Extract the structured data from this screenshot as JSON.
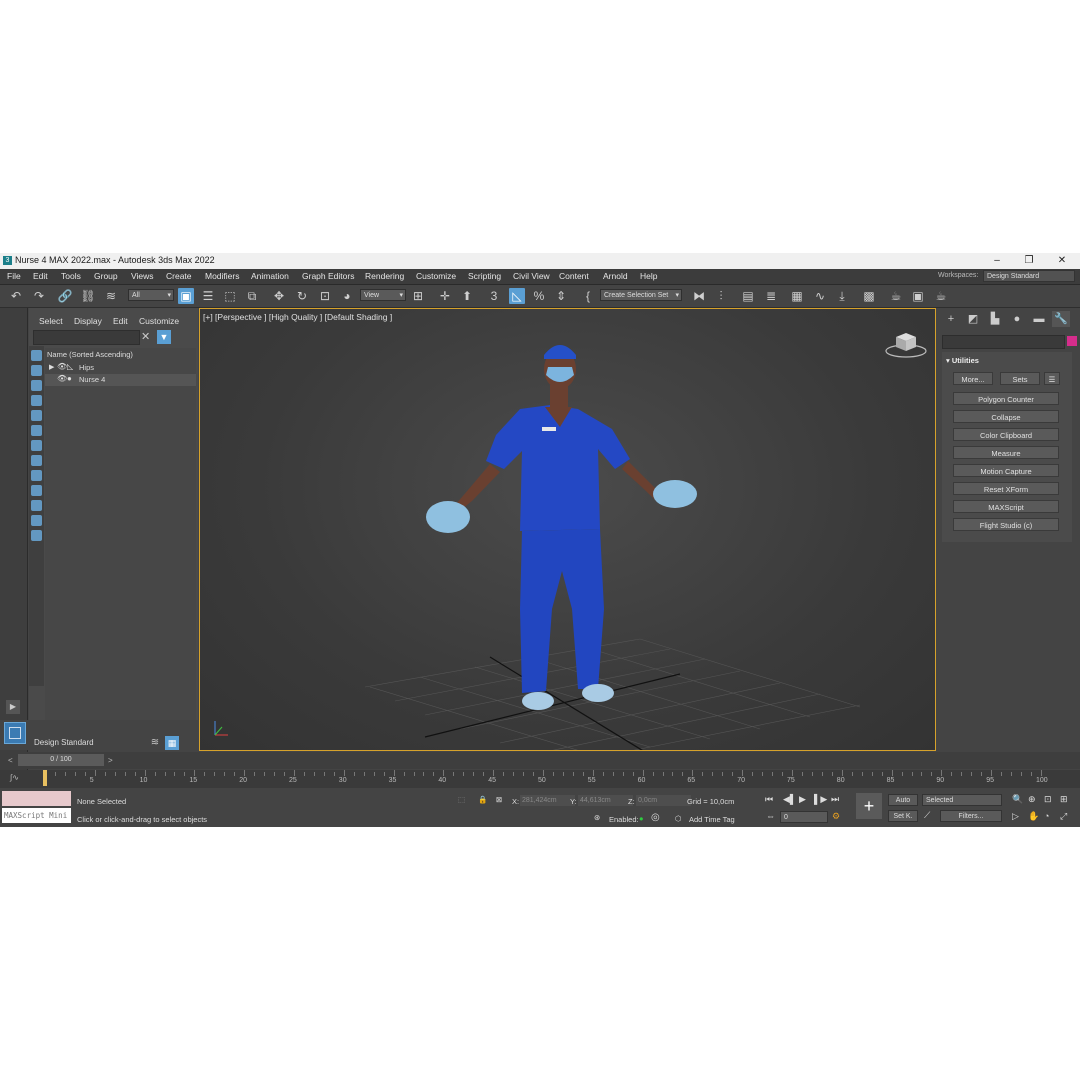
{
  "window": {
    "title": "Nurse 4 MAX 2022.max - Autodesk 3ds Max 2022",
    "minimize": "–",
    "maximize": "❐",
    "close": "✕"
  },
  "menu": [
    "File",
    "Edit",
    "Tools",
    "Group",
    "Views",
    "Create",
    "Modifiers",
    "Animation",
    "Graph Editors",
    "Rendering",
    "Customize",
    "Scripting",
    "Civil View",
    "Content",
    "Arnold",
    "Help"
  ],
  "workspace": {
    "label": "Workspaces:",
    "value": "Design Standard"
  },
  "toolbar": {
    "filter_value": "All",
    "refcoord_value": "View",
    "selection_set_placeholder": "Create Selection Set"
  },
  "explorer": {
    "tabs": [
      "Select",
      "Display",
      "Edit",
      "Customize"
    ],
    "column_header": "Name (Sorted Ascending)",
    "rows": [
      {
        "name": "Hips"
      },
      {
        "name": "Nurse 4"
      }
    ],
    "workspace_value": "Design Standard"
  },
  "viewport": {
    "label": "[+] [Perspective ] [High Quality ] [Default Shading ]"
  },
  "command_panel": {
    "rollout_title": "Utilities",
    "buttons": [
      "Polygon Counter",
      "Collapse",
      "Color Clipboard",
      "Measure",
      "Motion Capture",
      "Reset XForm",
      "MAXScript",
      "Flight Studio (c)"
    ],
    "more_label": "More...",
    "sets_label": "Sets",
    "object_color": "#d62d8c"
  },
  "timeline": {
    "slider_label": "0 / 100",
    "ticks": [
      "5",
      "10",
      "15",
      "20",
      "25",
      "30",
      "35",
      "40",
      "45",
      "50",
      "55",
      "60",
      "65",
      "70",
      "75",
      "80",
      "85",
      "90",
      "95",
      "100"
    ]
  },
  "status": {
    "maxscript_placeholder": "MAXScript Mini",
    "selection": "None Selected",
    "prompt": "Click or click-and-drag to select objects",
    "x_label": "X:",
    "x_value": "281,424cm",
    "y_label": "Y:",
    "y_value": "44,613cm",
    "z_label": "Z:",
    "z_value": "0,0cm",
    "grid": "Grid = 10,0cm",
    "enabled_label": "Enabled:",
    "add_time_tag": "Add Time Tag",
    "auto_label": "Auto",
    "setkey_label": "Set K.",
    "selected_value": "Selected",
    "filters_label": "Filters...",
    "frame_value": "0"
  }
}
